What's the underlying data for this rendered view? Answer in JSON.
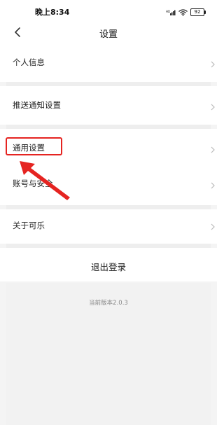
{
  "status_bar": {
    "time": "晚上8:34",
    "signal_label": "HD",
    "battery": "92"
  },
  "header": {
    "title": "设置"
  },
  "settings": {
    "items": [
      {
        "label": "个人信息"
      },
      {
        "label": "推送通知设置"
      },
      {
        "label": "通用设置"
      },
      {
        "label": "账号与安全"
      },
      {
        "label": "关于可乐"
      }
    ]
  },
  "logout": {
    "label": "退出登录"
  },
  "footer": {
    "version": "当前版本2.0.3"
  },
  "colors": {
    "annotation": "#e52421",
    "background": "#f4f4f4",
    "row": "#ffffff"
  },
  "icons": {
    "back": "back-arrow-icon",
    "chevron": "chevron-right-icon",
    "wifi": "wifi-icon",
    "signal": "signal-icon",
    "battery": "battery-icon"
  }
}
